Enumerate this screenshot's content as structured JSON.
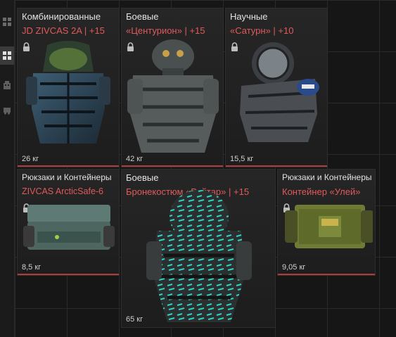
{
  "sidebar": {
    "buttons": [
      {
        "icon": "grid-icon",
        "active": false
      },
      {
        "icon": "grid-icon",
        "active": true
      },
      {
        "icon": "building-icon",
        "active": false
      },
      {
        "icon": "truck-icon",
        "active": false
      }
    ]
  },
  "items": [
    {
      "category": "Комбинированные",
      "name": "JD ZIVCAS 2A  | +15",
      "weight": "26 кг",
      "locked": true,
      "art": "armor-blue-helmet"
    },
    {
      "category": "Боевые",
      "name": "«Центурион» | +15",
      "weight": "42 кг",
      "locked": true,
      "art": "armor-heavy-grey"
    },
    {
      "category": "Научные",
      "name": "«Сатурн» | +10",
      "weight": "15,5 кг",
      "locked": true,
      "art": "armor-scientist"
    },
    {
      "category": "Рюкзаки и Контейнеры",
      "name": "ZIVCAS ArcticSafe-6",
      "weight": "8,5 кг",
      "locked": true,
      "art": "container-teal"
    },
    {
      "category": "Боевые",
      "name": "Бронекостюм «Рейтар» | +15",
      "weight": "65 кг",
      "locked": false,
      "art": "armor-reytar"
    },
    {
      "category": "Рюкзаки и Контейнеры",
      "name": "Контейнер «Улей»",
      "weight": "9,05 кг",
      "locked": true,
      "art": "container-green"
    }
  ],
  "colors": {
    "accent": "#e05a5a",
    "underline": "#b03c3c",
    "background": "#141414"
  }
}
